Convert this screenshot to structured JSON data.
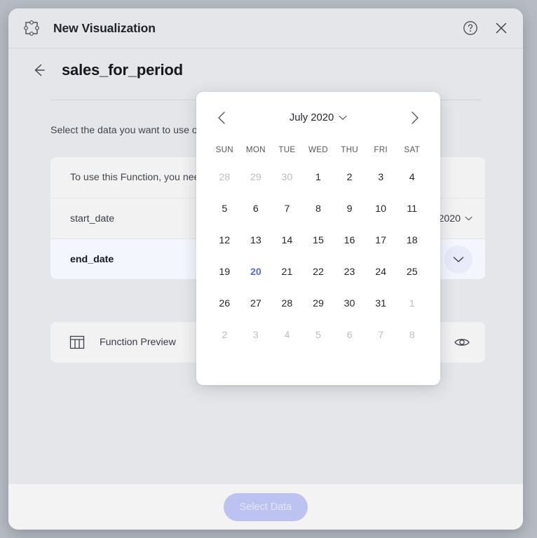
{
  "window": {
    "app_icon": "shape-nodes-icon",
    "title": "New Visualization",
    "help_icon": "help-circle-icon",
    "close_icon": "close-icon"
  },
  "subheader": {
    "back_icon": "arrow-left-icon",
    "function_name": "sales_for_period"
  },
  "content": {
    "instruction": "Select the data you want to use on the Function",
    "rows": [
      {
        "label": "To use this Function, you need to select the parameters below",
        "type": "note",
        "value": "",
        "has_chevron": false
      },
      {
        "label": "start_date",
        "type": "plain",
        "value": "2020",
        "has_chevron": true
      },
      {
        "label": "end_date",
        "type": "active",
        "value": "",
        "has_chevron": false
      }
    ],
    "preview": {
      "icon": "table-icon",
      "label": "Function Preview",
      "action_icon": "eye-icon"
    }
  },
  "calendar": {
    "prev_icon": "chevron-left-icon",
    "next_icon": "chevron-right-icon",
    "month_label": "July 2020",
    "month_chevron_icon": "chevron-down-icon",
    "weekdays": [
      "SUN",
      "MON",
      "TUE",
      "WED",
      "THU",
      "FRI",
      "SAT"
    ],
    "today": 20,
    "weeks": [
      [
        {
          "d": "28",
          "o": true
        },
        {
          "d": "29",
          "o": true
        },
        {
          "d": "30",
          "o": true
        },
        {
          "d": "1",
          "o": false
        },
        {
          "d": "2",
          "o": false
        },
        {
          "d": "3",
          "o": false
        },
        {
          "d": "4",
          "o": false
        }
      ],
      [
        {
          "d": "5",
          "o": false
        },
        {
          "d": "6",
          "o": false
        },
        {
          "d": "7",
          "o": false
        },
        {
          "d": "8",
          "o": false
        },
        {
          "d": "9",
          "o": false
        },
        {
          "d": "10",
          "o": false
        },
        {
          "d": "11",
          "o": false
        }
      ],
      [
        {
          "d": "12",
          "o": false
        },
        {
          "d": "13",
          "o": false
        },
        {
          "d": "14",
          "o": false
        },
        {
          "d": "15",
          "o": false
        },
        {
          "d": "16",
          "o": false
        },
        {
          "d": "17",
          "o": false
        },
        {
          "d": "18",
          "o": false
        }
      ],
      [
        {
          "d": "19",
          "o": false
        },
        {
          "d": "20",
          "o": false,
          "today": true
        },
        {
          "d": "21",
          "o": false
        },
        {
          "d": "22",
          "o": false
        },
        {
          "d": "23",
          "o": false
        },
        {
          "d": "24",
          "o": false
        },
        {
          "d": "25",
          "o": false
        }
      ],
      [
        {
          "d": "26",
          "o": false
        },
        {
          "d": "27",
          "o": false
        },
        {
          "d": "28",
          "o": false
        },
        {
          "d": "29",
          "o": false
        },
        {
          "d": "30",
          "o": false
        },
        {
          "d": "31",
          "o": false
        },
        {
          "d": "1",
          "o": true
        }
      ],
      [
        {
          "d": "2",
          "o": true
        },
        {
          "d": "3",
          "o": true
        },
        {
          "d": "4",
          "o": true
        },
        {
          "d": "5",
          "o": true
        },
        {
          "d": "6",
          "o": true
        },
        {
          "d": "7",
          "o": true
        },
        {
          "d": "8",
          "o": true
        }
      ]
    ]
  },
  "footer": {
    "select_data_label": "Select Data"
  },
  "colors": {
    "backdrop": "#b7bcc4",
    "dialog": "#e4e6ea",
    "row": "#f2f2f3",
    "row_active": "#f4f6fe",
    "accent": "#5468f0",
    "button_disabled": "#bcc3f1",
    "footer": "#f3f3f4"
  }
}
